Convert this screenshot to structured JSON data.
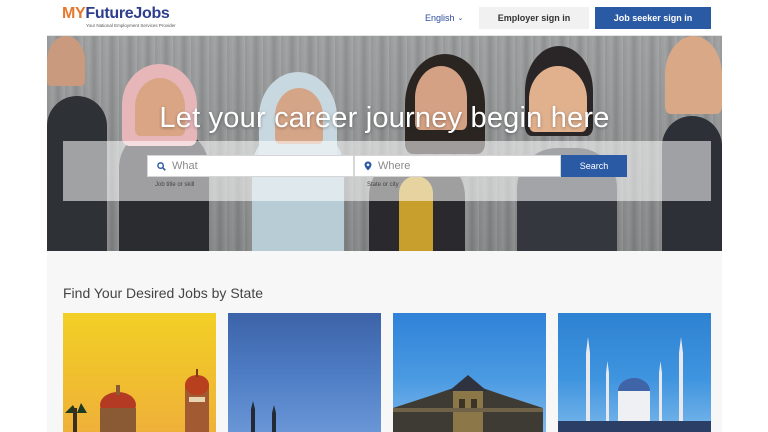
{
  "header": {
    "logo": {
      "brand_my": "MY",
      "brand_rest": "FutureJobs",
      "tagline": "Your National Employment Services Provider"
    },
    "language": {
      "label": "English",
      "icon": "chevron-down-icon"
    },
    "employer_signin_label": "Employer sign in",
    "jobseeker_signin_label": "Job seeker sign in"
  },
  "hero": {
    "title": "Let your career journey begin here",
    "search": {
      "what": {
        "placeholder": "What",
        "value": "",
        "hint": "Job title or skill",
        "icon": "search-icon"
      },
      "where": {
        "placeholder": "Where",
        "value": "",
        "hint": "State or city",
        "icon": "location-pin-icon"
      },
      "button_label": "Search"
    }
  },
  "states_section": {
    "title": "Find Your Desired Jobs by State"
  },
  "colors": {
    "primary": "#2b5aa5",
    "logo_orange": "#e8772e",
    "logo_navy": "#2d3e8c"
  }
}
